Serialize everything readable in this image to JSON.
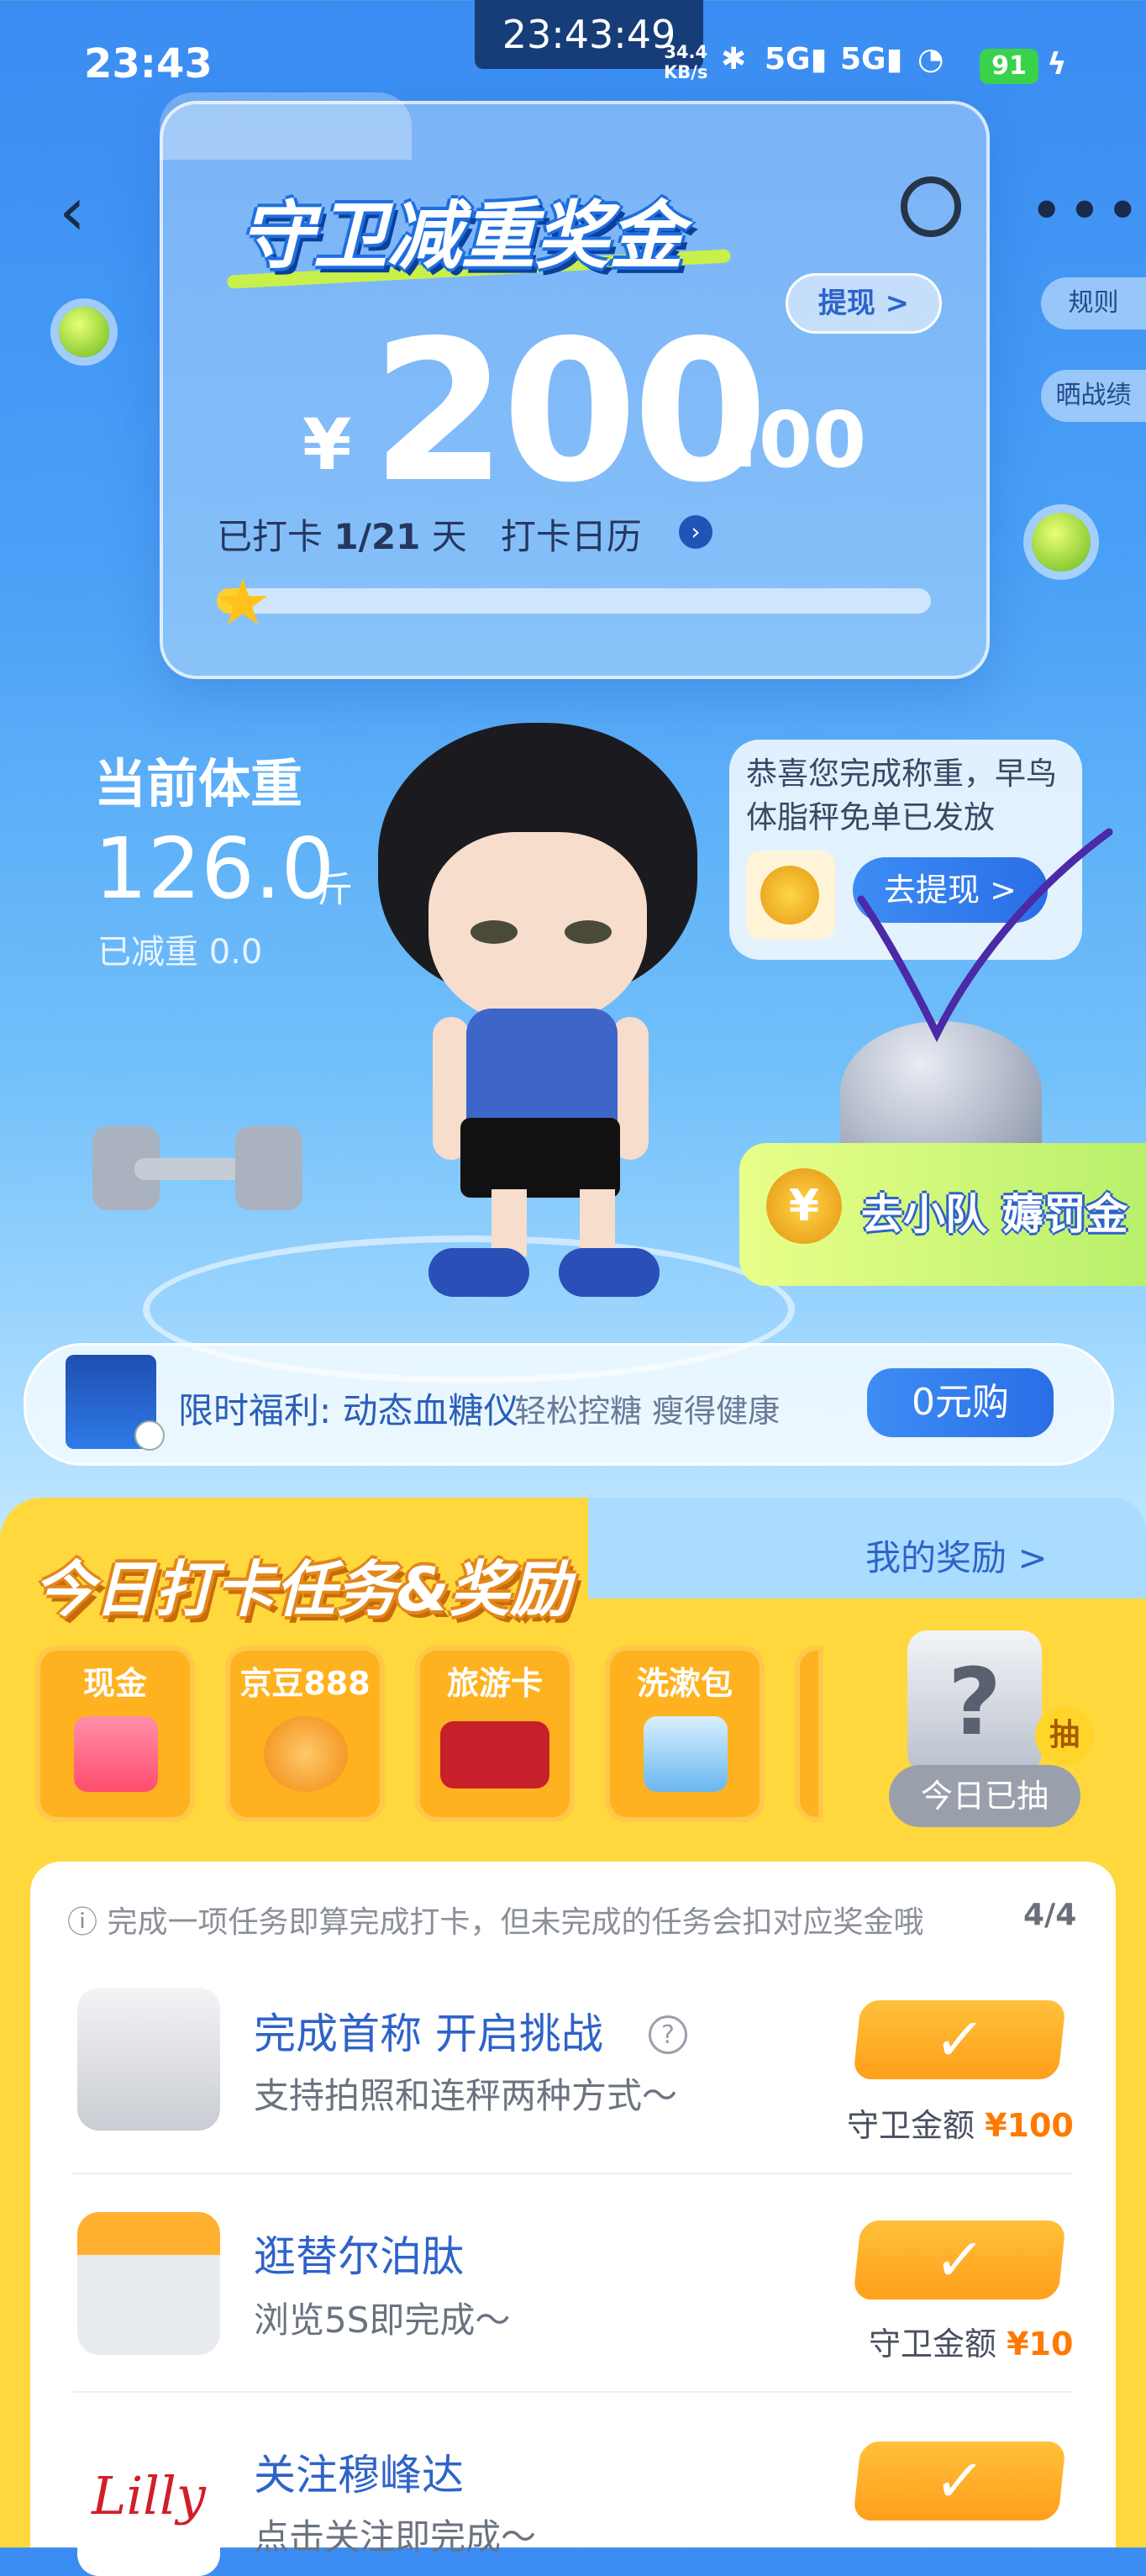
{
  "status_bar": {
    "time": "23:43",
    "center_clock": "23:43:49",
    "net_speed_value": "34.4",
    "net_speed_unit": "KB/s",
    "signal_1": "5G",
    "signal_2": "5G",
    "battery": "91"
  },
  "header": {
    "title": "守卫减重奖金",
    "withdraw_label": "提现 >",
    "side_rules": "规则",
    "side_share": "晒战绩"
  },
  "bonus": {
    "currency": "¥",
    "amount_int": "200",
    "amount_dec": ".00",
    "checkin_prefix": "已打卡",
    "checkin_count": "1/21",
    "checkin_suffix": "天",
    "calendar_label": "打卡日历",
    "progress": 0.0476
  },
  "weight": {
    "label": "当前体重",
    "value": "126.0",
    "unit": "斤",
    "lost": "已减重 0.0"
  },
  "bubble": {
    "message": "恭喜您完成称重，早鸟体脂秤免单已发放",
    "button": "去提现 >"
  },
  "team_banner": {
    "coin": "¥",
    "text": "去小队 薅罚金"
  },
  "promo": {
    "title": "限时福利: 动态血糖仪",
    "subtitle": "轻松控糖 瘦得健康",
    "button": "0元购"
  },
  "tasks_section": {
    "title": "今日打卡任务&奖励",
    "my_reward": "我的奖励 >",
    "rewards": [
      {
        "name": "现金"
      },
      {
        "name": "京豆888"
      },
      {
        "name": "旅游卡"
      },
      {
        "name": "洗漱包"
      }
    ],
    "lucky_symbol": "?",
    "lucky_tag": "抽",
    "lucky_button": "今日已抽",
    "notice": "完成一项任务即算完成打卡，但未完成的任务会扣对应奖金哦",
    "notice_count": "4/4",
    "items": [
      {
        "name": "完成首称 开启挑战",
        "desc": "支持拍照和连秤两种方式～",
        "reward_label": "守卫金额",
        "reward_value": "¥100",
        "done": "✓"
      },
      {
        "name": "逛替尔泊肽",
        "desc": "浏览5S即完成～",
        "reward_label": "守卫金额",
        "reward_value": "¥10",
        "done": "✓"
      },
      {
        "name": "关注穆峰达",
        "desc": "点击关注即完成～",
        "reward_label": "",
        "reward_value": "",
        "done": "✓"
      }
    ]
  },
  "colors": {
    "accent_blue": "#2e63c9",
    "task_yellow": "#ffd83d",
    "orange": "#ff9f1a"
  }
}
